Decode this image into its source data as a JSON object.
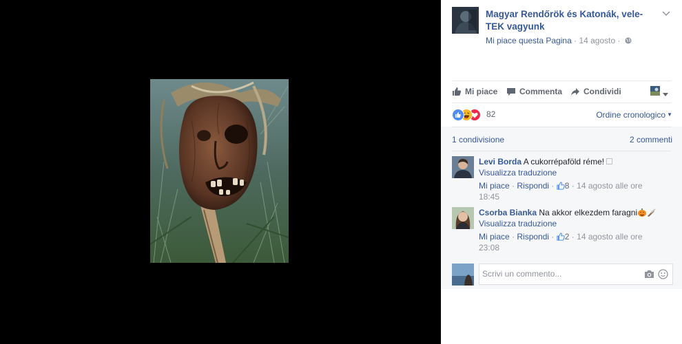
{
  "post": {
    "page_name": "Magyar Rendőrök és Katonák, vele-TEK vagyunk",
    "like_page": "Mi piace questa Pagina",
    "date": "14 agosto",
    "dot": "·"
  },
  "actions": {
    "like": "Mi piace",
    "comment": "Commenta",
    "share": "Condividi"
  },
  "reactions": {
    "count": "82",
    "order": "Ordine cronologico",
    "types": [
      "like-icon",
      "haha-icon",
      "love-icon"
    ]
  },
  "stats": {
    "shares": "1 condivisione",
    "comments": "2 commenti"
  },
  "comments": [
    {
      "name": "Levi Borda",
      "text": "A cukorrépaföld réme!",
      "translate": "Visualizza traduzione",
      "like": "Mi piace",
      "reply": "Rispondi",
      "likes": "8",
      "time_a": "14 agosto alle ore",
      "time_b": "18:45"
    },
    {
      "name": "Csorba Bianka",
      "text": "Na akkor elkezdem faragni",
      "translate": "Visualizza traduzione",
      "like": "Mi piace",
      "reply": "Rispondi",
      "likes": "2",
      "time_a": "14 agosto alle ore",
      "time_b": "23:08"
    }
  ],
  "composer": {
    "placeholder": "Scrivi un commento..."
  },
  "colors": {
    "link": "#365899",
    "muted": "#90949c",
    "action": "#606770",
    "like_blue": "#4e8df5",
    "haha_yellow": "#f7b928",
    "love_red": "#f0284a"
  }
}
